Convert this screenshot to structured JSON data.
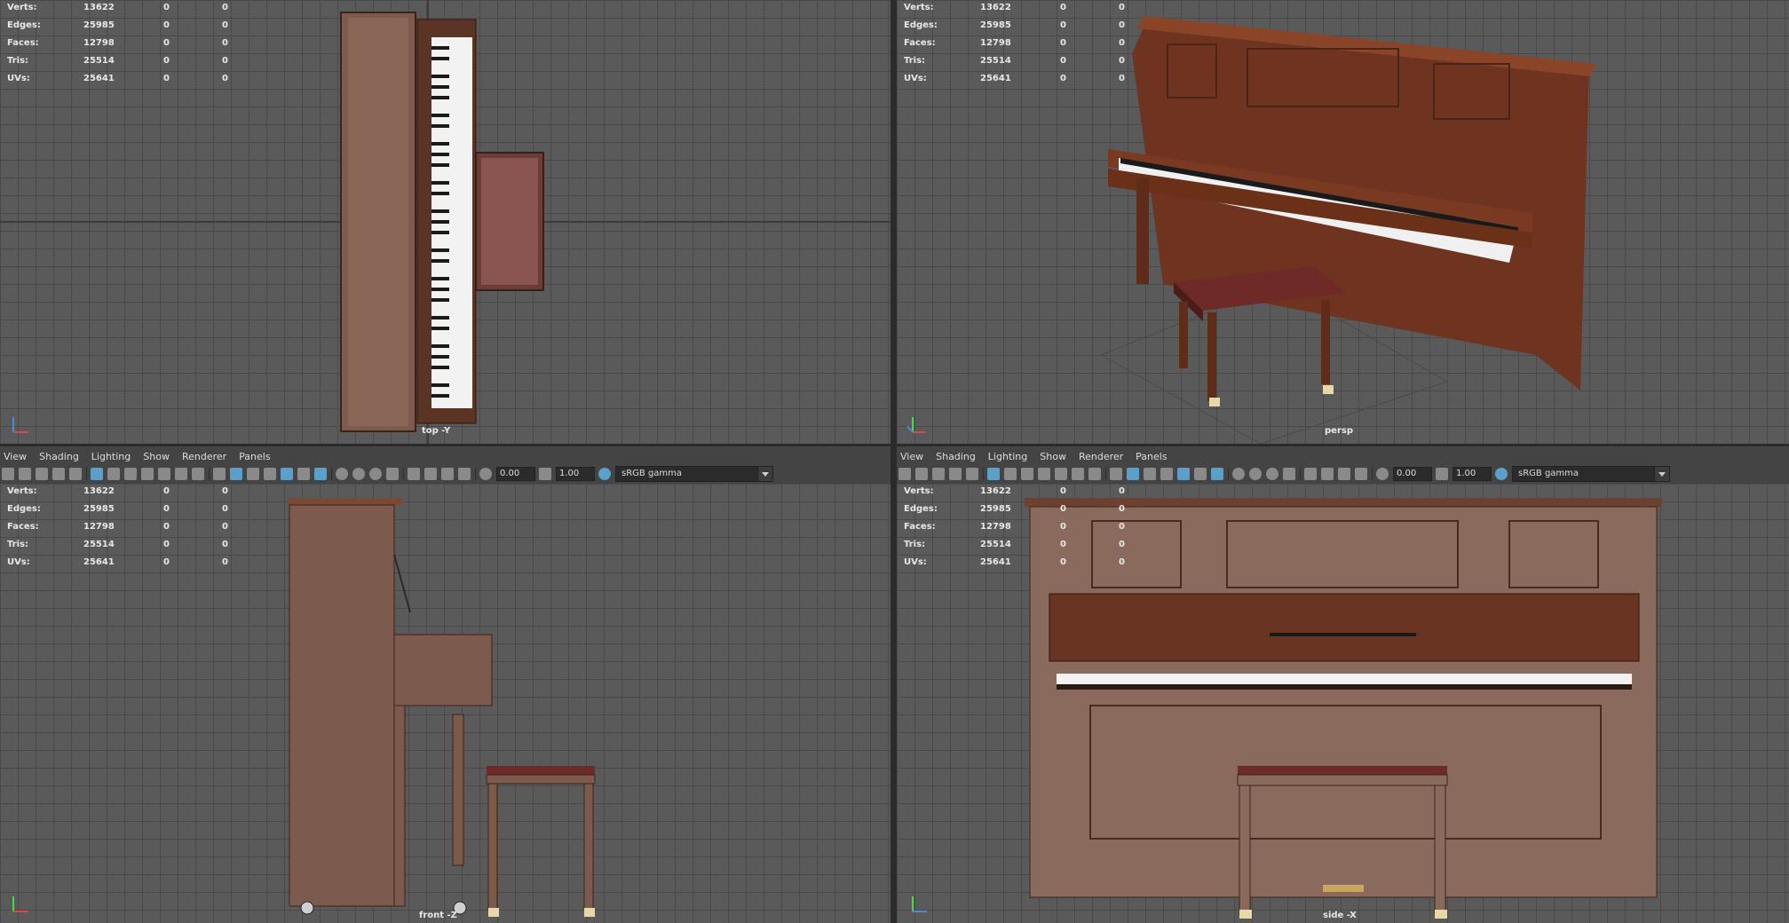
{
  "stats": {
    "rows": [
      {
        "label": "Verts:",
        "v1": "13622",
        "v2": "0",
        "v3": "0"
      },
      {
        "label": "Edges:",
        "v1": "25985",
        "v2": "0",
        "v3": "0"
      },
      {
        "label": "Faces:",
        "v1": "12798",
        "v2": "0",
        "v3": "0"
      },
      {
        "label": "Tris:",
        "v1": "25514",
        "v2": "0",
        "v3": "0"
      },
      {
        "label": "UVs:",
        "v1": "25641",
        "v2": "0",
        "v3": "0"
      }
    ]
  },
  "viewports": {
    "top": {
      "label": "top -Y"
    },
    "persp": {
      "label": "persp"
    },
    "front": {
      "label": "front -Z"
    },
    "side": {
      "label": "side -X"
    }
  },
  "panel_menu": [
    "View",
    "Shading",
    "Lighting",
    "Show",
    "Renderer",
    "Panels"
  ],
  "toolbar": {
    "exposure": "0.00",
    "gamma": "1.00",
    "color_space": "sRGB gamma"
  },
  "colors": {
    "wood": "#7a3a22",
    "grid": "#5a5a5a",
    "accent": "#5aa0c8"
  }
}
